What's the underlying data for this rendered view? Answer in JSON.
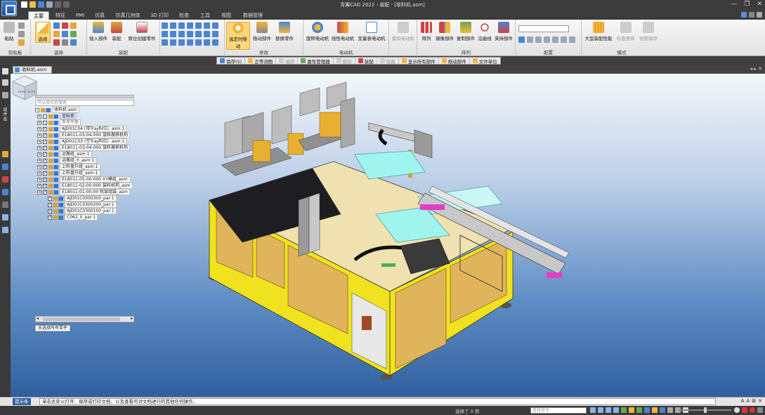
{
  "window": {
    "title": "青翼CAD 2022 - 装配 - [收料机.asm]",
    "controls": [
      "—",
      "❐",
      "✕"
    ]
  },
  "tabs": [
    {
      "label": "主要",
      "active": true
    },
    {
      "label": "特征",
      "active": false
    },
    {
      "label": "PMI",
      "active": false
    },
    {
      "label": "仿真",
      "active": false
    },
    {
      "label": "仿真几何体",
      "active": false
    },
    {
      "label": "3D 打印",
      "active": false
    },
    {
      "label": "检查",
      "active": false
    },
    {
      "label": "工具",
      "active": false
    },
    {
      "label": "视图",
      "active": false
    },
    {
      "label": "数据管理",
      "active": false
    }
  ],
  "ribbon": {
    "clipboard": {
      "label": "剪贴板",
      "paste": "粘贴"
    },
    "select": {
      "label": "选择",
      "button": "选择"
    },
    "assemble": {
      "label": "装配",
      "insert_part": "插入部件",
      "assemble": "装配",
      "create_in_place": "原位创建零件"
    },
    "modify": {
      "label": "修改",
      "drag": "选定时移动",
      "pull_part": "拖动部件",
      "replace_part": "替换零件"
    },
    "motor": {
      "label": "电动机",
      "rotary": "旋转电动机",
      "linear": "线性电动机",
      "variable": "变量表电动机"
    },
    "simulate": {
      "hide_motor": "模拟电动机"
    },
    "pattern": {
      "label": "阵列",
      "pattern": "阵列",
      "mirror_part": "镜像部件",
      "copy_part": "复制部件",
      "along_curve": "沿曲线",
      "fasten_part": "夹持部件"
    },
    "config": {
      "label": "配置"
    },
    "mode": {
      "label": "模式",
      "large_assembly": "大型装配性能",
      "checked_out": "检查更新",
      "view_save": "视图保存"
    }
  },
  "toolbar2": [
    {
      "label": "保存(S)",
      "disabled": false
    },
    {
      "label": "正等测图",
      "disabled": false
    },
    {
      "label": "编辑",
      "disabled": true
    },
    {
      "label": "属性管理器",
      "disabled": false
    },
    {
      "label": "删除",
      "disabled": true
    },
    {
      "label": "装配",
      "disabled": false
    },
    {
      "label": "隐藏",
      "disabled": true
    },
    {
      "label": "显示所有部件",
      "disabled": false
    },
    {
      "label": "拖动部件",
      "disabled": false
    },
    {
      "label": "文件单位",
      "disabled": false
    }
  ],
  "left_strip": {
    "vertical_label": "组件库"
  },
  "document": {
    "tab": "收料机.asm"
  },
  "tree": {
    "search_placeholder": "可以按名称搜索",
    "root": "收料机.asm",
    "rows": [
      {
        "label": "坐标系",
        "exp": "+",
        "chk": false,
        "cls": "sel"
      },
      {
        "label": "参考平面",
        "exp": "+",
        "chk": false,
        "cls": "grey"
      },
      {
        "label": "AJD01C04 (带Tray料位) .asm:1",
        "exp": "+",
        "chk": true,
        "cls": ""
      },
      {
        "label": "E18011-03-04-000 旋料搬移机构",
        "exp": "+",
        "chk": true,
        "cls": ""
      },
      {
        "label": "AJD01C03 (空Tray料位) .asm:1",
        "exp": "+",
        "chk": true,
        "cls": ""
      },
      {
        "label": "E18011-03-04-000 旋料搬移机构",
        "exp": "+",
        "chk": true,
        "cls": ""
      },
      {
        "label": "运搬组_asm:1",
        "exp": "+",
        "chk": true,
        "cls": ""
      },
      {
        "label": "运搬组_0_asm:1",
        "exp": "+",
        "chk": true,
        "cls": ""
      },
      {
        "label": "上料盘升组_asm:1",
        "exp": "+",
        "chk": true,
        "cls": ""
      },
      {
        "label": "上料盘升组_asm:1",
        "exp": "+",
        "chk": true,
        "cls": ""
      },
      {
        "label": "E18011-05-00-000 XY模组_asm:",
        "exp": "+",
        "chk": true,
        "cls": ""
      },
      {
        "label": "E18011-02-00-000 装料机构_asm",
        "exp": "+",
        "chk": true,
        "cls": ""
      },
      {
        "label": "E18011-01-00-00 机架组装_asm",
        "exp": "+",
        "chk": true,
        "cls": ""
      },
      {
        "label": "AJD01C0300300_par:1",
        "exp": "",
        "chk": true,
        "cls": ""
      },
      {
        "label": "AJD01C0300200_par:1",
        "exp": "",
        "chk": true,
        "cls": ""
      },
      {
        "label": "AJD01C0300100_par:1",
        "exp": "",
        "chk": true,
        "cls": ""
      },
      {
        "label": "C062_0_par:1",
        "exp": "",
        "chk": true,
        "cls": ""
      }
    ],
    "status": "未选择所有零件"
  },
  "viewcube": {
    "front": "FRONT",
    "right": "RIGHT"
  },
  "prompt": {
    "label": "提示条",
    "text": "单击此处以打开、保存或打印文档，以及查看可对文档进行的其他任何操作。"
  },
  "status": {
    "selected": "选择了 0 项",
    "search_placeholder": "查找命令"
  },
  "colors": {
    "accent": "#2f5f9e",
    "frame_yellow": "#f1e21f",
    "panel_orange": "#e0b45b",
    "machine_grey": "#b8b8b8",
    "cyan_part": "#9ff4ee"
  }
}
